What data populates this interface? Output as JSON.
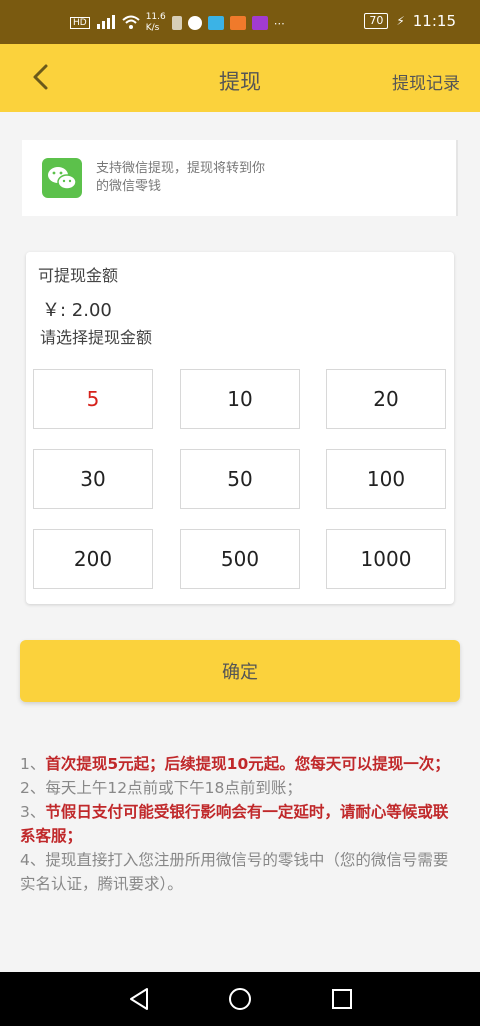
{
  "status_bar": {
    "speed_value": "11.6",
    "speed_unit": "K/s",
    "battery": "70",
    "time": "11:15"
  },
  "header": {
    "title": "提现",
    "records_label": "提现记录"
  },
  "notice": {
    "text": "支持微信提现，提现将转到你的微信零钱"
  },
  "withdraw": {
    "label": "可提现金额",
    "balance": "￥: 2.00",
    "select_hint": "请选择提现金额",
    "amounts": [
      "5",
      "10",
      "20",
      "30",
      "50",
      "100",
      "200",
      "500",
      "1000"
    ],
    "selected": "5"
  },
  "confirm_label": "确定",
  "rules": [
    {
      "num": "1、",
      "text": "首次提现5元起；后续提现10元起。您每天可以提现一次；",
      "style": "red"
    },
    {
      "num": "2、",
      "text": "每天上午12点前或下午18点前到账；",
      "style": "grey"
    },
    {
      "num": "3、",
      "text": "节假日支付可能受银行影响会有一定延时，请耐心等候或联系客服；",
      "style": "red"
    },
    {
      "num": "4、",
      "text": "提现直接打入您注册所用微信号的零钱中（您的微信号需要实名认证，腾讯要求）。",
      "style": "grey"
    }
  ],
  "colors": {
    "accent": "#fbd23c",
    "selected_amount": "#d6221c",
    "rule_highlight": "#c0282a",
    "wechat": "#5cc14b"
  }
}
